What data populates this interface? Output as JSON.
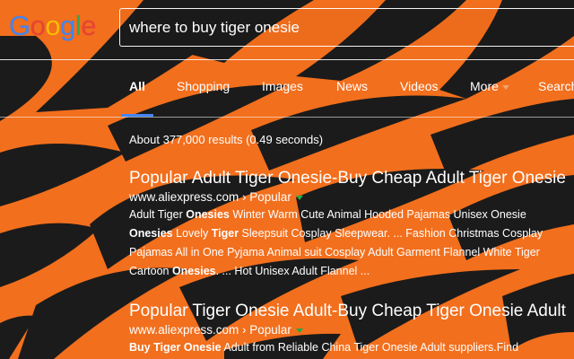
{
  "colors": {
    "background": "#f26f1d",
    "stripes": "#1b1b1b",
    "active_tab_underline": "#4285f4",
    "url_caret": "#22aa44"
  },
  "logo": {
    "letters": [
      {
        "char": "G",
        "color": "#4285f4"
      },
      {
        "char": "o",
        "color": "#ea4335"
      },
      {
        "char": "o",
        "color": "#fbbc05"
      },
      {
        "char": "g",
        "color": "#4285f4"
      },
      {
        "char": "l",
        "color": "#34a853"
      },
      {
        "char": "e",
        "color": "#ea4335"
      }
    ]
  },
  "search": {
    "query": "where to buy tiger onesie"
  },
  "tabs": [
    {
      "label": "All",
      "active": true
    },
    {
      "label": "Shopping",
      "active": false
    },
    {
      "label": "Images",
      "active": false
    },
    {
      "label": "News",
      "active": false
    },
    {
      "label": "Videos",
      "active": false
    },
    {
      "label": "More",
      "active": false,
      "icon": "caret-down-icon"
    },
    {
      "label": "Search",
      "active": false
    }
  ],
  "result_stats": "About 377,000 results (0.49 seconds)",
  "results": [
    {
      "title": "Popular Adult Tiger Onesie-Buy Cheap Adult Tiger Onesie",
      "url": "www.aliexpress.com › Popular",
      "snippet_lines": [
        [
          {
            "t": "Adult Tiger "
          },
          {
            "t": "Onesies",
            "b": true
          },
          {
            "t": " Winter Warm Cute Animal Hooded Pajamas Unisex Onesie"
          }
        ],
        [
          {
            "t": "Onesies",
            "b": true
          },
          {
            "t": " Lovely "
          },
          {
            "t": "Tiger",
            "b": true
          },
          {
            "t": " Sleepsuit Cosplay Sleepwear. ... Fashion Christmas Cosplay"
          }
        ],
        [
          {
            "t": "Pajamas All in One Pyjama Animal suit Cosplay Adult Garment Flannel White Tiger"
          }
        ],
        [
          {
            "t": "Cartoon "
          },
          {
            "t": "Onesies",
            "b": true
          },
          {
            "t": ". ... Hot Unisex Adult Flannel ..."
          }
        ]
      ]
    },
    {
      "title": "Popular Tiger Onesie Adult-Buy Cheap Tiger Onesie Adult",
      "url": "www.aliexpress.com › Popular",
      "snippet_lines": [
        [
          {
            "t": "Buy Tiger Onesie",
            "b": true
          },
          {
            "t": " Adult from Reliable China Tiger Onesie Adult suppliers.Find"
          }
        ]
      ]
    }
  ]
}
